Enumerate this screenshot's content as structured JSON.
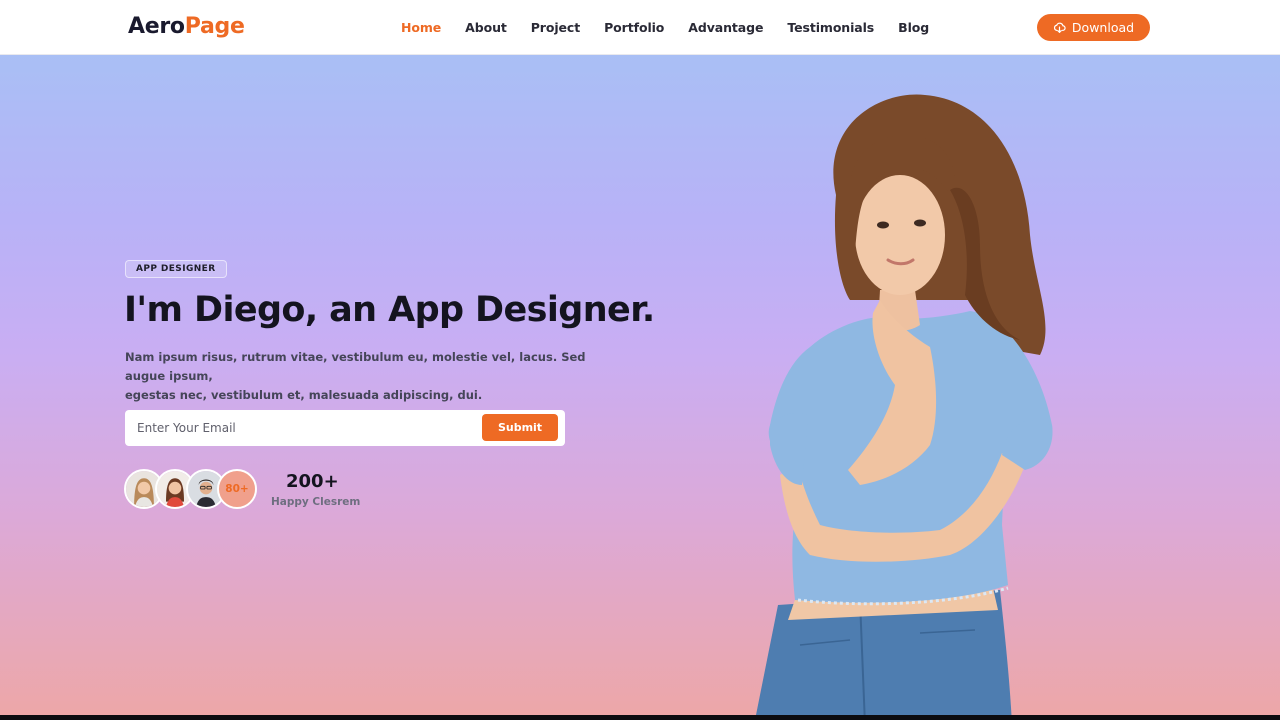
{
  "header": {
    "logo_part1": "Aero",
    "logo_part2": "Page",
    "nav": [
      {
        "label": "Home",
        "active": true
      },
      {
        "label": "About"
      },
      {
        "label": "Project"
      },
      {
        "label": "Portfolio"
      },
      {
        "label": "Advantage"
      },
      {
        "label": "Testimonials"
      },
      {
        "label": "Blog"
      }
    ],
    "download_label": "Download",
    "download_icon": "cloud-download-icon"
  },
  "hero": {
    "badge": "APP DESIGNER",
    "title": "I'm Diego, an App Designer.",
    "description_line1": "Nam ipsum risus, rutrum vitae, vestibulum eu, molestie vel, lacus. Sed augue ipsum,",
    "description_line2": "egestas nec, vestibulum et, malesuada adipiscing, dui.",
    "email_placeholder": "Enter Your Email",
    "submit_label": "Submit",
    "avatar_count": "80+",
    "stat_value": "200+",
    "stat_label": "Happy Clesrem"
  },
  "colors": {
    "accent": "#ee6a24",
    "text_dark": "#14141f",
    "gradient_top": "#a9bff5",
    "gradient_bottom": "#eda7a8"
  }
}
